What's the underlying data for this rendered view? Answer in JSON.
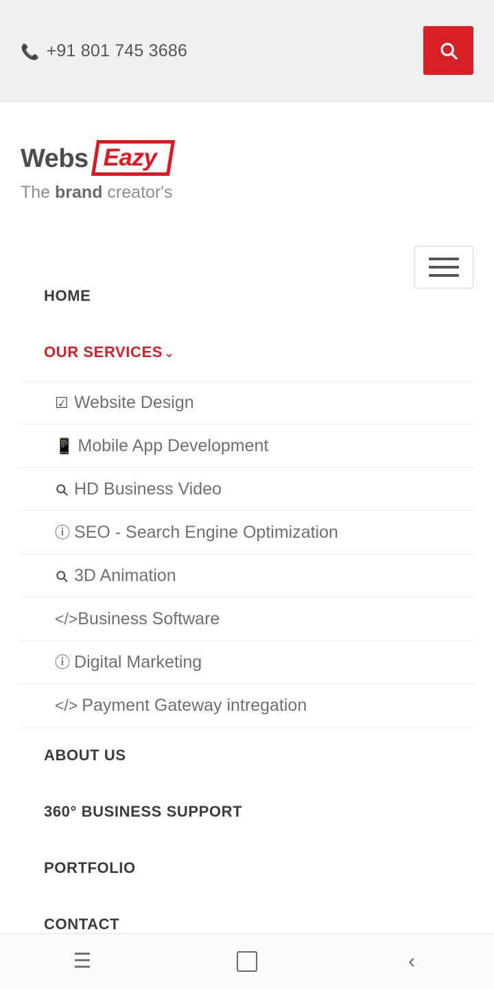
{
  "topbar": {
    "phone": "+91 801 745 3686",
    "phone_icon": "phone-icon",
    "search_icon": "search-icon",
    "search_button_color": "#d81f26"
  },
  "brand": {
    "logo_word1": "Webs",
    "logo_word2": "Eazy",
    "tagline_pre": "The ",
    "tagline_bold": "brand",
    "tagline_post": " creator's",
    "menu_toggle": "hamburger-icon"
  },
  "nav": {
    "items": [
      {
        "label": "HOME",
        "active": false
      },
      {
        "label": "OUR SERVICES",
        "active": true,
        "caret": "⌄"
      },
      {
        "label": "ABOUT US",
        "active": false
      },
      {
        "label": "360° BUSINESS SUPPORT",
        "active": false
      },
      {
        "label": "PORTFOLIO",
        "active": false
      },
      {
        "label": "CONTACT",
        "active": false
      }
    ],
    "submenu": [
      {
        "icon": "✔",
        "icon_name": "check-square-icon",
        "label": "Website Design"
      },
      {
        "icon": "▯",
        "icon_name": "mobile-icon",
        "label": "Mobile App Development"
      },
      {
        "icon": "search",
        "icon_name": "search-icon",
        "label": "HD Business Video"
      },
      {
        "icon": "ⓘ",
        "icon_name": "info-circle-icon",
        "label": "SEO - Search Engine Optimization"
      },
      {
        "icon": "search",
        "icon_name": "search-icon",
        "label": "3D Animation"
      },
      {
        "icon": "</>",
        "icon_name": "code-icon",
        "label": "Business Software"
      },
      {
        "icon": "ⓘ",
        "icon_name": "info-circle-icon",
        "label": "Digital Marketing"
      },
      {
        "icon": "</>",
        "icon_name": "code-icon",
        "label": "Payment Gateway intregation"
      }
    ]
  },
  "sysnav": {
    "menu": "☰",
    "home": "",
    "back": "‹"
  },
  "colors": {
    "accent": "#d81f26",
    "logo_red": "#e1161f",
    "text": "#555555",
    "topbar_bg": "#f0f0f0"
  }
}
